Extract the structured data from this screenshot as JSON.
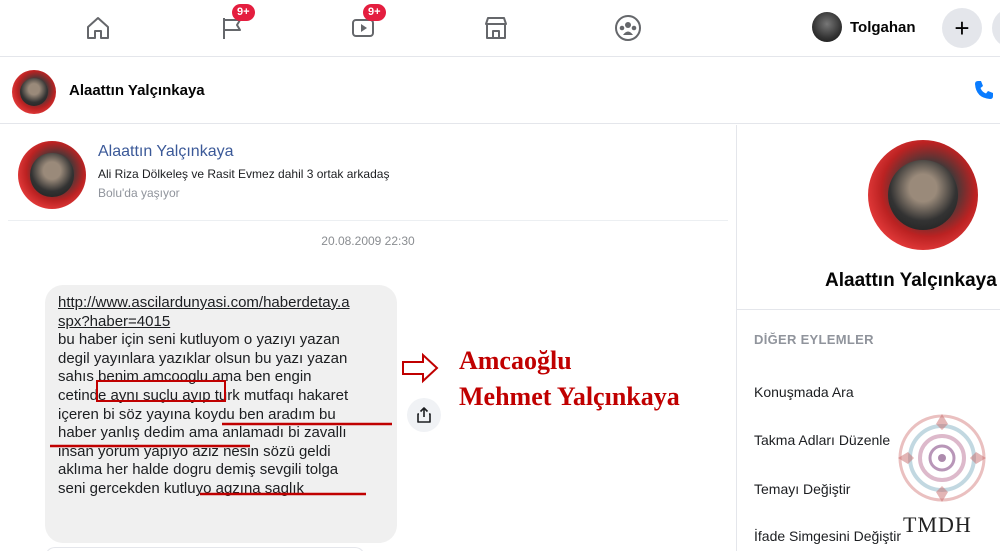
{
  "topnav": {
    "notif_badge": "9+",
    "video_badge": "9+",
    "user_name": "Tolgahan",
    "plus_label": "+"
  },
  "chat_header": {
    "name": "Alaattın Yalçınkaya"
  },
  "profile_card": {
    "name": "Alaattın Yalçınkaya",
    "mutual": "Ali Riza Dölkeleş ve Rasit Evmez dahil 3 ortak arkadaş",
    "location": "Bolu'da yaşıyor"
  },
  "message": {
    "timestamp": "20.08.2009 22:30",
    "link_line1": "http://www.ascilardunyasi.com/haberdetay.a",
    "link_line2": "spx?haber=4015",
    "lines": [
      " bu haber için seni kutluyom o yazıyı yazan",
      "degil yayınlara yazıklar olsun bu yazı yazan",
      "sahıs benim amcooglu ama ben engin",
      "cetinde aynı suçlu ayıp turk mutfaqı hakaret",
      "içeren bi söz yayına koydu ben aradım bu",
      "haber yanlış dedim ama anlamadı bi zavallı",
      "insan yorum yapıyo aziz nesin sözü geldi",
      "aklıma her halde dogru demiş sevgili tolga",
      "seni gercekden kutluyo agzına saglık"
    ]
  },
  "annotation": {
    "line1": "Amcaoğlu",
    "line2": "Mehmet Yalçınkaya",
    "color": "#c00000"
  },
  "right_panel": {
    "name": "Alaattın Yalçınkaya",
    "section_title": "DİĞER EYLEMLER",
    "items": [
      "Konuşmada Ara",
      "Takma Adları Düzenle",
      "Temayı Değiştir",
      "İfade Simgesini Değiştir"
    ]
  },
  "watermark": {
    "text": "TMDH"
  }
}
